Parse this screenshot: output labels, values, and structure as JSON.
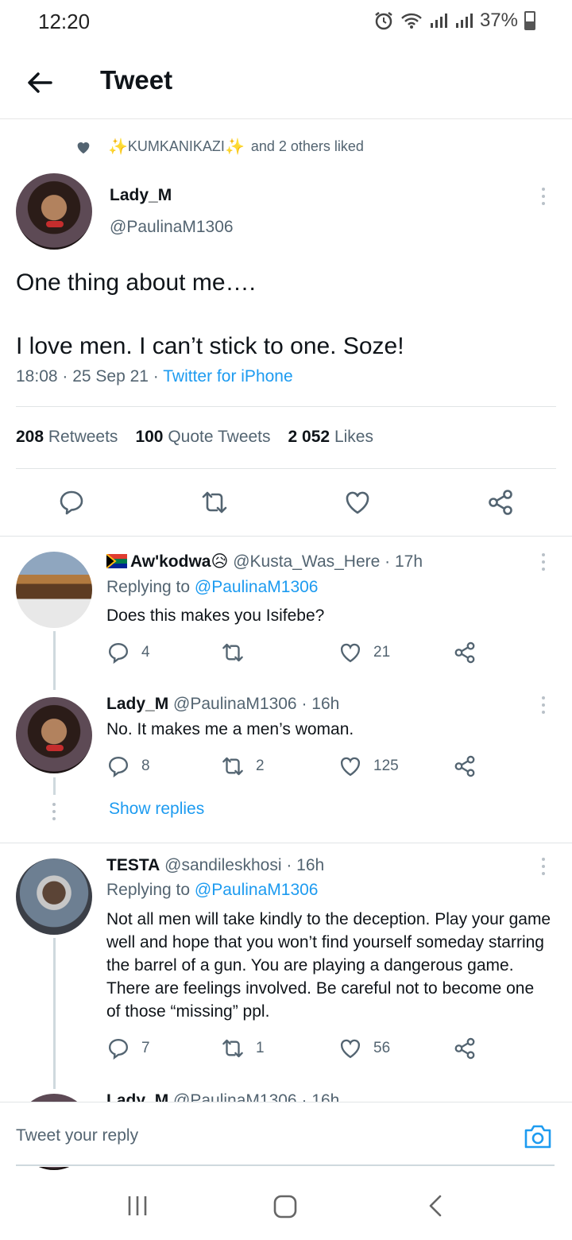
{
  "status_bar": {
    "time": "12:20",
    "battery": "37%"
  },
  "header": {
    "title": "Tweet"
  },
  "liked_by": {
    "sparkle_left": "✨",
    "name": "KUMKANIKAZI",
    "sparkle_right": "✨",
    "suffix": "and 2 others liked"
  },
  "tweet": {
    "name": "Lady_M",
    "handle": "@PaulinaM1306",
    "text": "One thing about me….\n\nI love men. I can’t stick to one. Soze!",
    "time": "18:08 · 25 Sep 21 · ",
    "source": "Twitter for iPhone",
    "stats": {
      "retweets_count": "208",
      "retweets_label": "Retweets",
      "quotes_count": "100",
      "quotes_label": "Quote Tweets",
      "likes_count": "2 052",
      "likes_label": "Likes"
    }
  },
  "replies": [
    {
      "name": "Aw'kodwa😥",
      "handle": "@Kusta_Was_Here · 17h",
      "replying_prefix": "Replying to ",
      "replying_to": "@PaulinaM1306",
      "text": "Does this makes you Isifebe?",
      "comments": "4",
      "retweets": "",
      "likes": "21"
    },
    {
      "name": "Lady_M",
      "handle": "@PaulinaM1306 · 16h",
      "text": "No. It makes me a men’s woman.",
      "comments": "8",
      "retweets": "2",
      "likes": "125"
    },
    {
      "name": "TESTA",
      "handle": "@sandileskhosi · 16h",
      "replying_prefix": "Replying to ",
      "replying_to": "@PaulinaM1306",
      "text": "Not all men will take kindly to the deception. Play your game well and hope that you won’t find yourself someday starring the barrel of a gun. You are playing a dangerous game. There are feelings involved. Be careful not to become one of those “missing” ppl.",
      "comments": "7",
      "retweets": "1",
      "likes": "56"
    },
    {
      "name": "Lady_M",
      "handle": "@PaulinaM1306 · 16h"
    }
  ],
  "show_replies": "Show replies",
  "reply_bar": {
    "placeholder": "Tweet your reply"
  },
  "colors": {
    "accent": "#1d9bf0",
    "text": "#0f1419",
    "muted": "#536471"
  }
}
